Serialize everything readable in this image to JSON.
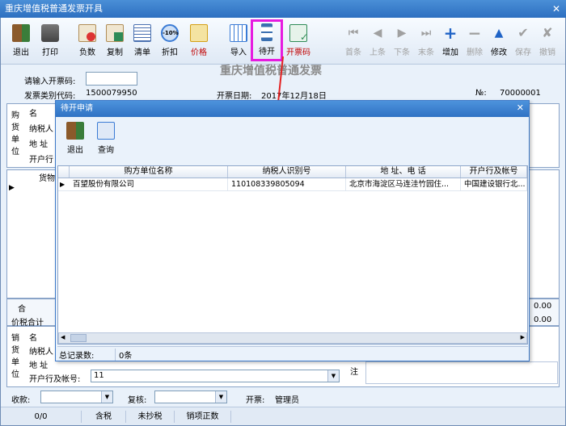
{
  "window": {
    "title": "重庆增值税普通发票开具",
    "close": "✕"
  },
  "toolbar": {
    "items": [
      {
        "label": "退出",
        "icon": "exit-icon",
        "color": "#8b5a2b"
      },
      {
        "label": "打印",
        "icon": "printer-icon",
        "color": "#555555"
      },
      {
        "label": "负数",
        "icon": "negative-invoice-icon",
        "color": "#cc3333"
      },
      {
        "label": "复制",
        "icon": "copy-icon",
        "color": "#2e8b57"
      },
      {
        "label": "清单",
        "icon": "list-icon",
        "color": "#4a70b0"
      },
      {
        "label": "折扣",
        "icon": "discount-icon",
        "badge": "-10%",
        "color": "#3a7bd5"
      },
      {
        "label": "价格",
        "icon": "price-icon",
        "color": "#d4a017"
      },
      {
        "label": "导入",
        "icon": "import-icon",
        "color": "#3a7bd5"
      },
      {
        "label": "待开",
        "icon": "hourglass-icon",
        "color": "#3a6fb0"
      },
      {
        "label": "开票码",
        "icon": "invoice-code-icon",
        "color": "#2e8b57"
      },
      {
        "label": "首条",
        "icon": "first-icon"
      },
      {
        "label": "上条",
        "icon": "prev-icon"
      },
      {
        "label": "下条",
        "icon": "next-icon"
      },
      {
        "label": "末条",
        "icon": "last-icon"
      },
      {
        "label": "增加",
        "icon": "plus-icon"
      },
      {
        "label": "删除",
        "icon": "minus-icon"
      },
      {
        "label": "修改",
        "icon": "edit-icon"
      },
      {
        "label": "保存",
        "icon": "check-icon"
      },
      {
        "label": "撤销",
        "icon": "undo-icon"
      }
    ]
  },
  "form": {
    "heading": "重庆增值税普通发票",
    "input_code_label": "请输入开票码:",
    "category_code_label": "发票类别代码:",
    "category_code": "1500079950",
    "date_label": "开票日期:",
    "date": "2017年12月18日",
    "no_label": "№:",
    "no": "70000001",
    "buyer_side_label": "购货单位",
    "name_label": "名",
    "taxpayer_label": "纳税人",
    "address_label": "地 址",
    "bank_label": "开户行",
    "goods_header": "货物",
    "total_label": "合",
    "tax_total_label": "价税合计",
    "total_value": "0.00",
    "tax_value": "0.00",
    "seller_side_label": "销货单位",
    "seller_name_label": "名",
    "seller_taxpayer_label": "纳税人",
    "seller_address_label": "地 址",
    "seller_bank_label": "开户行及帐号:",
    "seller_bank_value": "11",
    "note_label": "注",
    "payee_label": "收款:",
    "reviewer_label": "复核:",
    "drawer_label": "开票:",
    "drawer_value": "管理员"
  },
  "dialog": {
    "title": "待开申请",
    "close": "✕",
    "exit_label": "退出",
    "query_label": "查询",
    "columns": [
      "购方单位名称",
      "纳税人识别号",
      "地 址、电 话",
      "开户行及帐号"
    ],
    "rows": [
      [
        "百望股份有限公司",
        "110108339805094",
        "北京市海淀区马连洼竹园住...",
        "中国建设银行北..."
      ]
    ],
    "total_label": "总记录数:",
    "total_value": "0条"
  },
  "status": {
    "cells": [
      "0/0",
      "含税",
      "未抄税",
      "销项正数"
    ]
  }
}
